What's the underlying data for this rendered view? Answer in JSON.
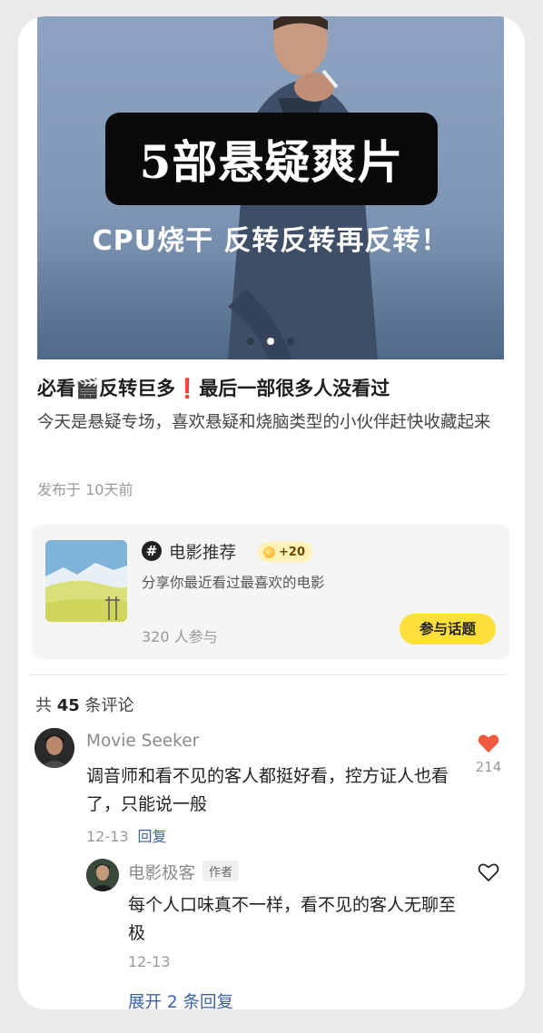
{
  "hero": {
    "title": "5部悬疑爽片",
    "subtitle": "CPU烧干 反转反转再反转！",
    "dots_total": 3,
    "dots_active": 2
  },
  "post": {
    "title": "必看🎬反转巨多❗最后一部很多人没看过",
    "description": "今天是悬疑专场，喜欢悬疑和烧脑类型的小伙伴赶快收藏起来",
    "time": "发布于 10天前"
  },
  "topic": {
    "hash_symbol": "#",
    "name": "电影推荐",
    "coin_text": "+20",
    "description": "分享你最近看过最喜欢的电影",
    "participants": "320 人参与",
    "join_label": "参与话题"
  },
  "comments_header": {
    "prefix": "共",
    "count": "45",
    "suffix": "条评论"
  },
  "comments": [
    {
      "author": "Movie Seeker",
      "text": "调音师和看不见的客人都挺好看，控方证人也看了，只能说一般",
      "date": "12-13",
      "reply_label": "回复",
      "likes": "214",
      "liked": true,
      "like_color": "#f2583e"
    }
  ],
  "reply": {
    "author": "电影极客",
    "author_tag": "作者",
    "text": "每个人口味真不一样，看不见的客人无聊至极",
    "date": "12-13",
    "liked": false
  },
  "expand_label": "展开 2 条回复"
}
